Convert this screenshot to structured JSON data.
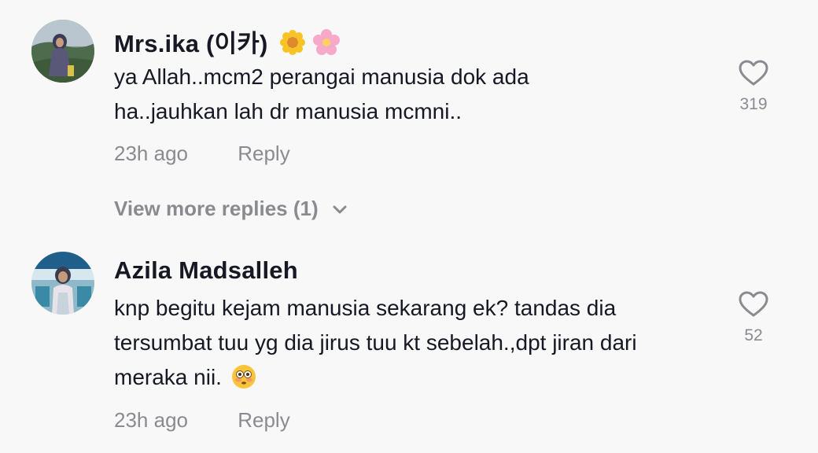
{
  "comments": [
    {
      "username": "Mrs.ika (이카)",
      "text_line1": "ya Allah..mcm2 perangai manusia dok ada",
      "text_line2": "ha..jauhkan lah dr manusia mcmni..",
      "time": "23h ago",
      "reply_label": "Reply",
      "likes": "319",
      "username_emojis": [
        "sunflower",
        "cherry-blossom"
      ]
    },
    {
      "username": "Azila Madsalleh",
      "text_line1": "knp begitu kejam manusia sekarang ek? tandas dia",
      "text_line2": "tersumbat tuu yg dia jirus tuu kt sebelah.,dpt jiran dari",
      "text_line3": "meraka nii.",
      "time": "23h ago",
      "reply_label": "Reply",
      "likes": "52",
      "text_emoji": "flushed-face"
    }
  ],
  "view_more_replies": "View more replies (1)",
  "colors": {
    "background": "#f8f8f8",
    "text": "#161823",
    "muted": "#8a8b91"
  }
}
